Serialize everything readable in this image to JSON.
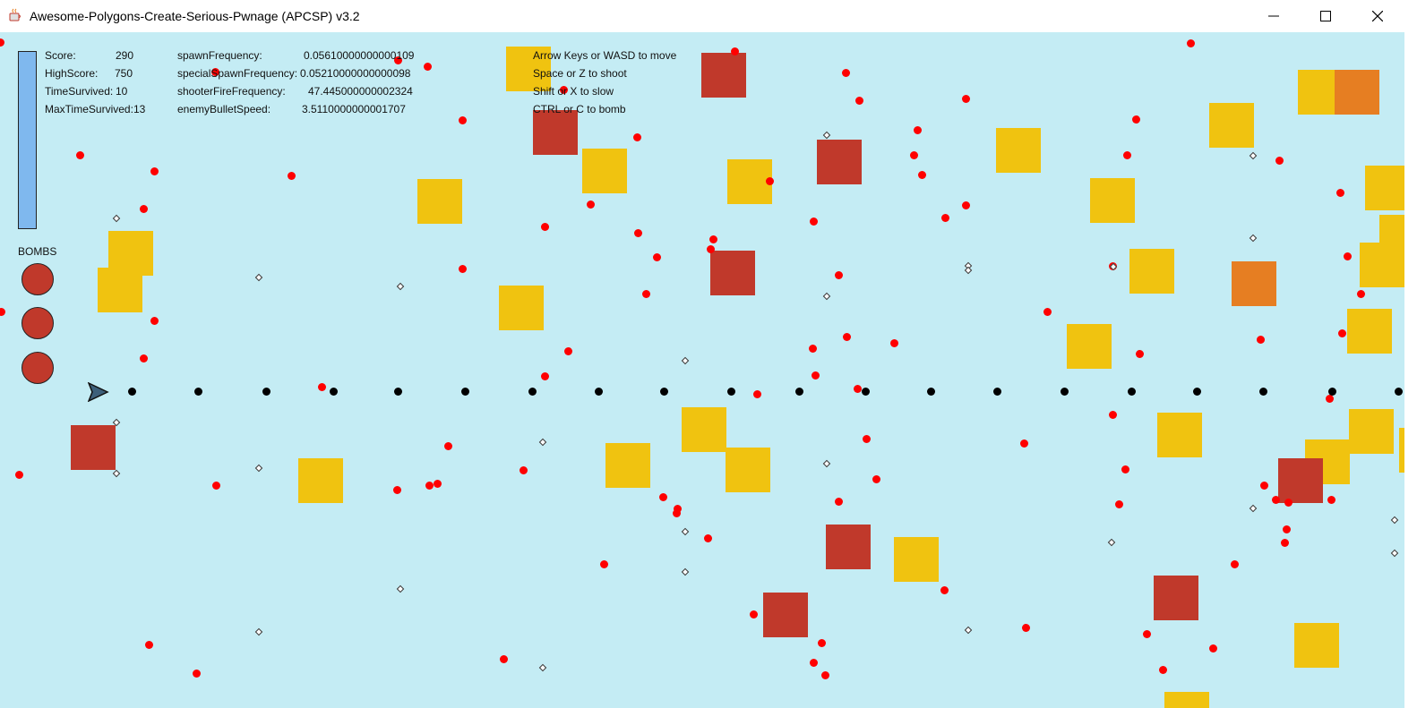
{
  "window": {
    "title": "Awesome-Polygons-Create-Serious-Pwnage (APCSP) v3.2",
    "icons": [
      "java-app-icon",
      "minimize-icon",
      "maximize-icon",
      "close-icon"
    ]
  },
  "hud": {
    "score_label": "Score:",
    "score_value": "290",
    "highscore_label": "HighScore:",
    "highscore_value": "750",
    "time_label": "TimeSurvived:",
    "time_value": "10",
    "maxtime_label": "MaxTimeSurvived:",
    "maxtime_value": "13",
    "spawn_label": "spawnFrequency:",
    "spawn_value": "0.05610000000000109",
    "special_label": "specialSpawnFrequency:",
    "special_value": "0.05210000000000098",
    "shooter_label": "shooterFireFrequency:",
    "shooter_value": "47.445000000002324",
    "bullet_label": "enemyBulletSpeed:",
    "bullet_value": "3.5110000000001707",
    "bombs_label": "BOMBS",
    "bombs_count": 3
  },
  "controls": {
    "move": "Arrow Keys or WASD to move",
    "shoot": "Space or Z to shoot",
    "slow": "Shift or X to slow",
    "bomb": "CTRL or C to bomb"
  },
  "colors": {
    "background": "#c4ecf4",
    "yellow_block": "#f0c310",
    "red_block": "#c0392b",
    "orange_block": "#e67e22",
    "enemy_bullet": "#ff0000",
    "player_bullet": "#000000",
    "gauge_fill": "#7fb8ee"
  }
}
